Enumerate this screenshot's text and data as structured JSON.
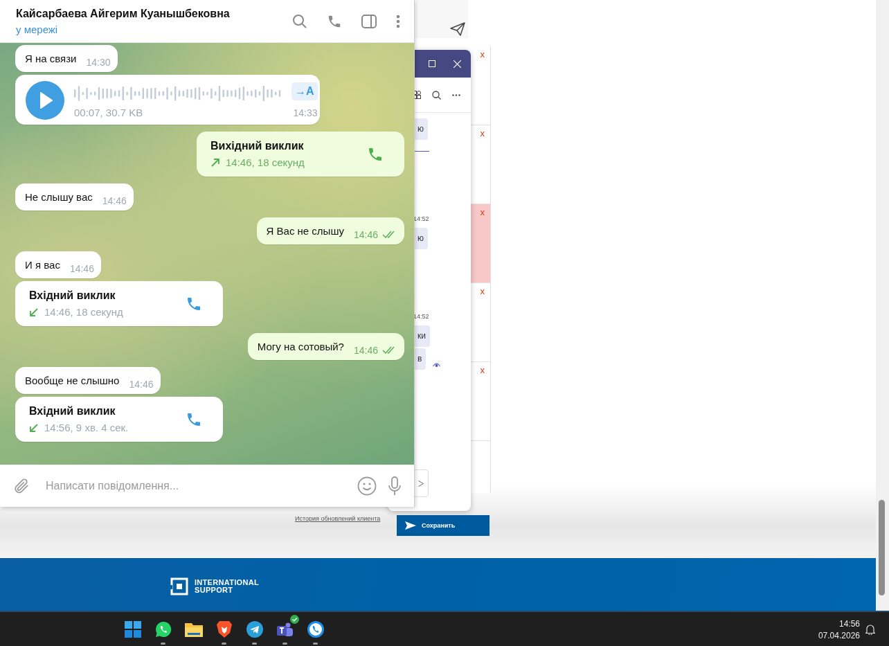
{
  "chat": {
    "title": "Кайсарбаева Айгерим Куанышбековна",
    "status": "у мережі",
    "input_placeholder": "Написати повідомлення...",
    "messages": [
      {
        "kind": "text",
        "outgoing": false,
        "text": "Я на связи",
        "time": "14:30"
      },
      {
        "kind": "voice",
        "outgoing": false,
        "info": "00:07, 30.7 KB",
        "transcribe": "→A",
        "time": "14:33"
      },
      {
        "kind": "call",
        "outgoing": true,
        "title": "Вихідний виклик",
        "detail": "14:46, 18 секунд"
      },
      {
        "kind": "text",
        "outgoing": false,
        "text": "Не слышу вас",
        "time": "14:46"
      },
      {
        "kind": "text",
        "outgoing": true,
        "text": "Я Вас не слышу",
        "time": "14:46",
        "read": true
      },
      {
        "kind": "text",
        "outgoing": false,
        "text": "И я вас",
        "time": "14:46"
      },
      {
        "kind": "call",
        "outgoing": false,
        "title": "Вхідний виклик",
        "detail": "14:46, 18 секунд"
      },
      {
        "kind": "text",
        "outgoing": true,
        "text": "Могу на сотовый?",
        "time": "14:46",
        "read": true
      },
      {
        "kind": "text",
        "outgoing": false,
        "text": "Вообще не слышно",
        "time": "14:46"
      },
      {
        "kind": "call",
        "outgoing": false,
        "title": "Вхідний виклик",
        "detail": "14:56, 9 хв. 4 сек."
      }
    ]
  },
  "side_rows": [
    {
      "mark": "x",
      "highlighted": false
    },
    {
      "mark": "x",
      "highlighted": false
    },
    {
      "mark": "x",
      "highlighted": true
    },
    {
      "mark": "x",
      "highlighted": false
    },
    {
      "mark": "x",
      "highlighted": false
    }
  ],
  "overlay_window": {
    "items": [
      {
        "kind": "bubble",
        "text": "ю"
      },
      {
        "kind": "time",
        "text": "14:52"
      },
      {
        "kind": "bubble",
        "text": "ю"
      },
      {
        "kind": "time",
        "text": "14:52"
      },
      {
        "kind": "bubble",
        "text": "ки"
      },
      {
        "kind": "bubble",
        "text": "в",
        "seen": true
      }
    ]
  },
  "page_footer": {
    "link": "История обновлений клиента",
    "save_button": "Сохранить",
    "logo_lines": [
      "INTERNATIONAL",
      "SUPPORT"
    ]
  },
  "taskbar": {
    "apps": [
      {
        "kind": "start"
      },
      {
        "kind": "whatsapp",
        "running": true
      },
      {
        "kind": "files"
      },
      {
        "kind": "brave",
        "running": true
      },
      {
        "kind": "telegram",
        "running": true
      },
      {
        "kind": "teams",
        "running": true,
        "badge": true
      },
      {
        "kind": "phone",
        "running": true
      }
    ],
    "time": "14:56",
    "date": "07.04.2026"
  }
}
